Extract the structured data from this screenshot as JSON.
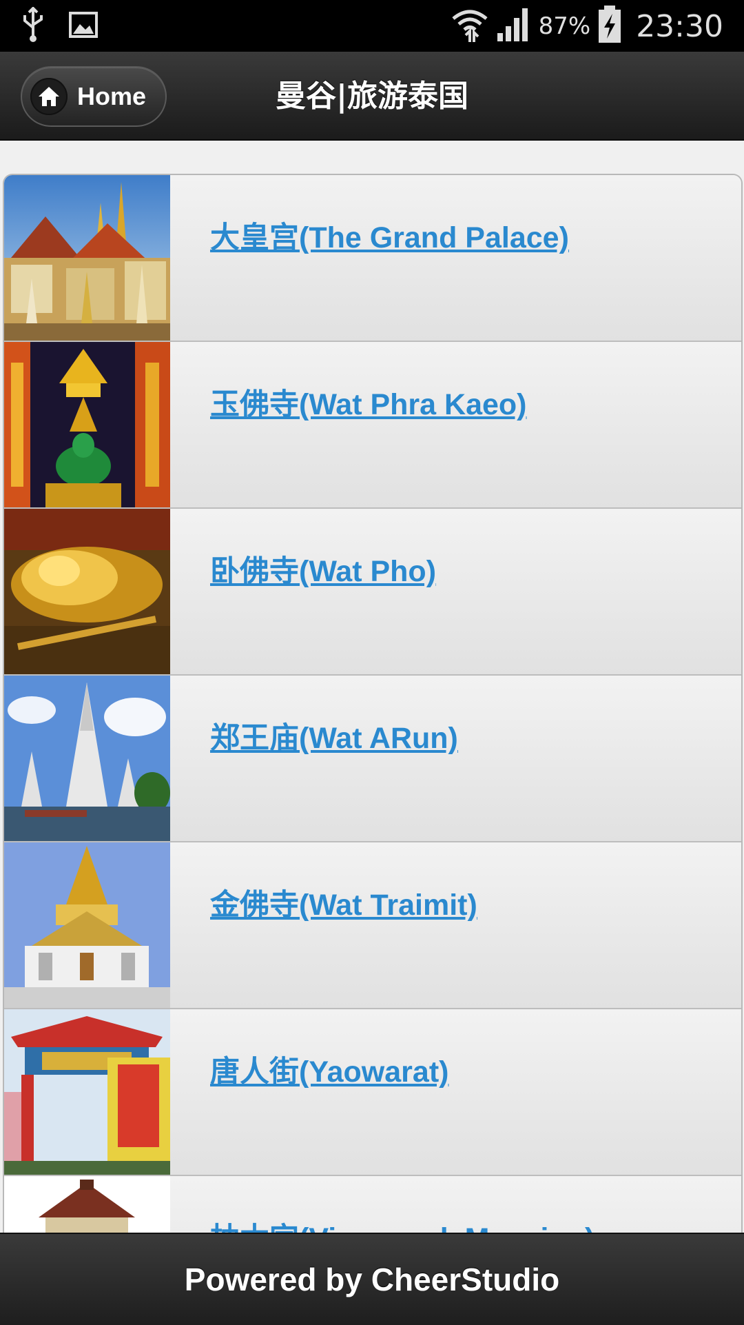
{
  "status_bar": {
    "icons": [
      "usb-icon",
      "image-notification-icon",
      "wifi-icon",
      "signal-icon",
      "battery-charging-icon"
    ],
    "battery_percent": "87%",
    "time": "23:30"
  },
  "header": {
    "home_label": "Home",
    "title": "曼谷|旅游泰国"
  },
  "list": {
    "items": [
      {
        "label": "大皇宫(The Grand Palace)",
        "thumb": "grand-palace-thumbnail"
      },
      {
        "label": "玉佛寺(Wat Phra Kaeo)",
        "thumb": "emerald-buddha-thumbnail"
      },
      {
        "label": "卧佛寺(Wat Pho)",
        "thumb": "reclining-buddha-thumbnail"
      },
      {
        "label": "郑王庙(Wat ARun)",
        "thumb": "wat-arun-thumbnail"
      },
      {
        "label": "金佛寺(Wat Traimit)",
        "thumb": "golden-buddha-temple-thumbnail"
      },
      {
        "label": "唐人街(Yaowarat)",
        "thumb": "chinatown-gate-thumbnail"
      },
      {
        "label": "柚木宫(Vimanmek Mansion)",
        "thumb": "vimanmek-mansion-thumbnail"
      }
    ]
  },
  "footer": {
    "text": "Powered by CheerStudio"
  },
  "colors": {
    "link": "#2a89cf",
    "header_bg": "#1b1b1b",
    "list_bg": "#e8e8e8"
  }
}
